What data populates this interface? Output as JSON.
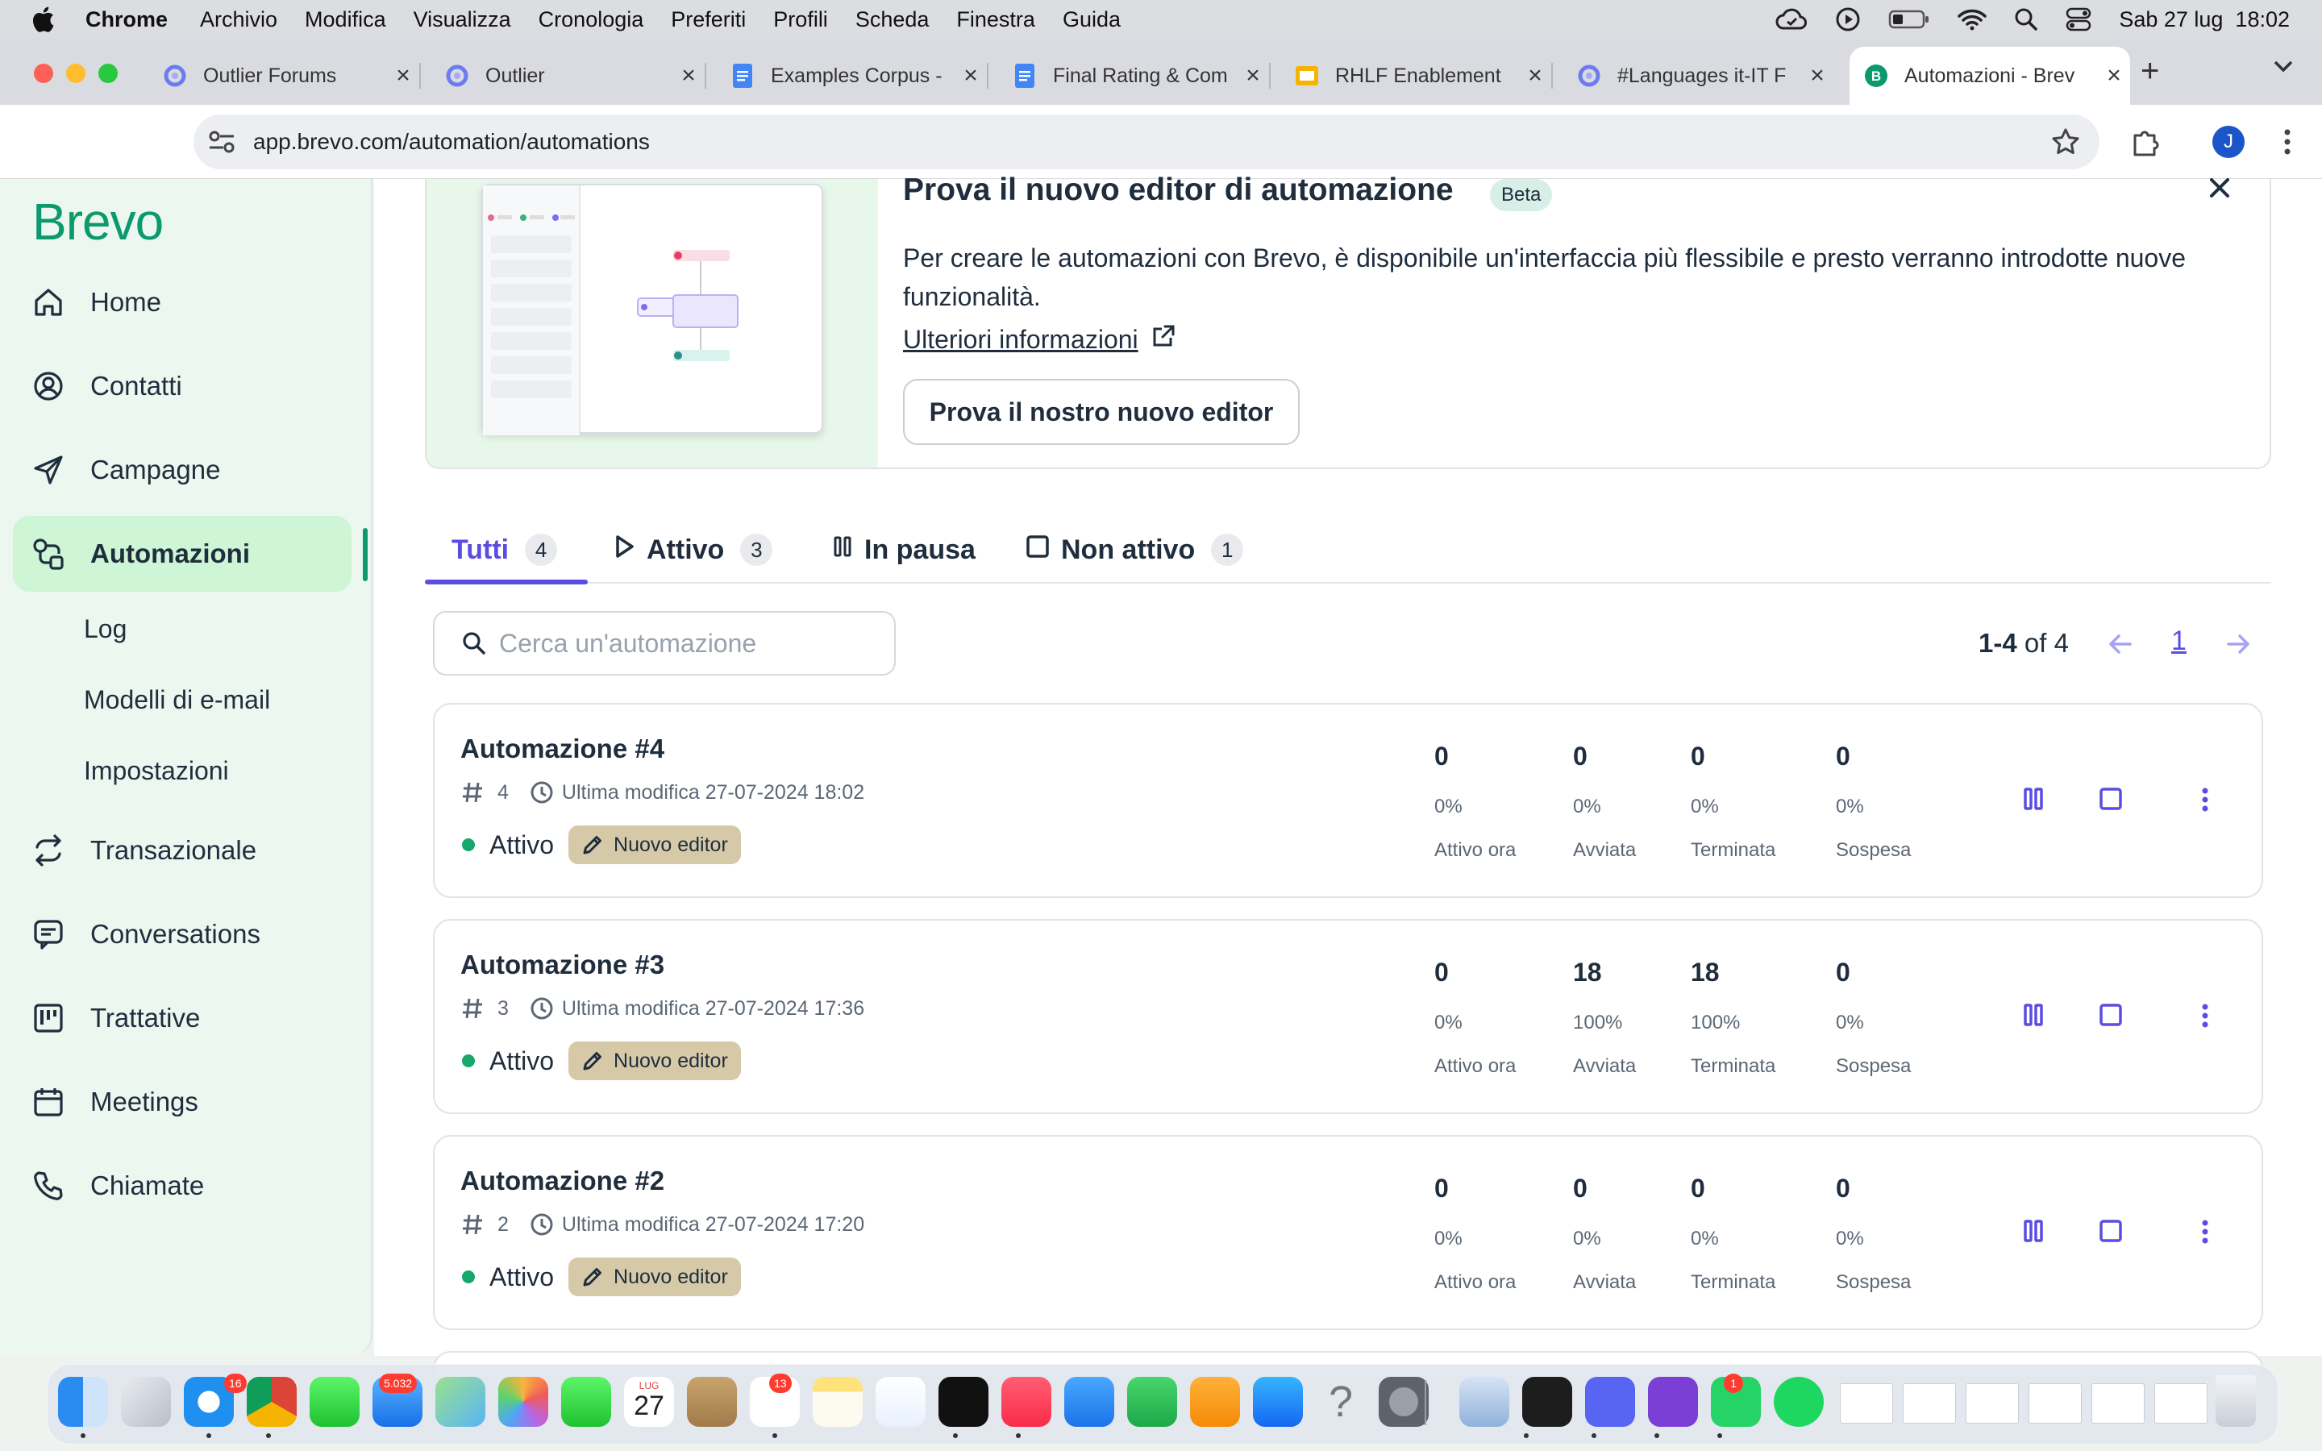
{
  "menubar": {
    "app": "Chrome",
    "items": [
      "Archivio",
      "Modifica",
      "Visualizza",
      "Cronologia",
      "Preferiti",
      "Profili",
      "Scheda",
      "Finestra",
      "Guida"
    ],
    "datetime": "Sab 27 lug  18:02"
  },
  "tabs": [
    {
      "title": "Outlier Forums",
      "icon": "outlier-icon"
    },
    {
      "title": "Outlier",
      "icon": "outlier-icon"
    },
    {
      "title": "Examples Corpus -",
      "icon": "google-docs-icon"
    },
    {
      "title": "Final Rating & Com",
      "icon": "google-docs-icon"
    },
    {
      "title": "RHLF Enablement",
      "icon": "google-slides-icon"
    },
    {
      "title": "#Languages it-IT F",
      "icon": "outlier-icon"
    },
    {
      "title": "Automazioni - Brev",
      "icon": "brevo-icon"
    }
  ],
  "address": {
    "url": "app.brevo.com/automation/automations"
  },
  "profile_initial": "J",
  "sidebar": {
    "logo": "Brevo",
    "items": [
      {
        "label": "Home",
        "icon": "home-icon"
      },
      {
        "label": "Contatti",
        "icon": "contacts-icon"
      },
      {
        "label": "Campagne",
        "icon": "send-icon"
      },
      {
        "label": "Automazioni",
        "icon": "automation-icon"
      },
      {
        "label": "Transazionale",
        "icon": "transactional-icon"
      },
      {
        "label": "Conversations",
        "icon": "chat-icon"
      },
      {
        "label": "Trattative",
        "icon": "deals-icon"
      },
      {
        "label": "Meetings",
        "icon": "calendar-icon"
      },
      {
        "label": "Chiamate",
        "icon": "phone-icon"
      }
    ],
    "sub_items": [
      "Log",
      "Modelli di e-mail",
      "Impostazioni"
    ]
  },
  "banner": {
    "title": "Prova il nuovo editor di automazione",
    "badge": "Beta",
    "description": "Per creare le automazioni con Brevo, è disponibile un'interfaccia più flessibile e presto verranno introdotte nuove funzionalità.",
    "link": "Ulteriori informazioni",
    "button": "Prova il nostro nuovo editor"
  },
  "filter_tabs": [
    {
      "label": "Tutti",
      "count": "4"
    },
    {
      "label": "Attivo",
      "count": "3"
    },
    {
      "label": "In pausa",
      "count": ""
    },
    {
      "label": "Non attivo",
      "count": "1"
    }
  ],
  "search": {
    "placeholder": "Cerca un'automazione"
  },
  "pagination": {
    "range": "1-4",
    "of": "of 4",
    "page": "1"
  },
  "automations": [
    {
      "title": "Automazione #4",
      "id": "4",
      "modified": "Ultima modifica 27-07-2024 18:02",
      "status": "Attivo",
      "editor": "Nuovo editor",
      "stats": [
        {
          "n": "0",
          "p": "0%",
          "l": "Attivo ora"
        },
        {
          "n": "0",
          "p": "0%",
          "l": "Avviata"
        },
        {
          "n": "0",
          "p": "0%",
          "l": "Terminata"
        },
        {
          "n": "0",
          "p": "0%",
          "l": "Sospesa"
        }
      ]
    },
    {
      "title": "Automazione #3",
      "id": "3",
      "modified": "Ultima modifica 27-07-2024 17:36",
      "status": "Attivo",
      "editor": "Nuovo editor",
      "stats": [
        {
          "n": "0",
          "p": "0%",
          "l": "Attivo ora"
        },
        {
          "n": "18",
          "p": "100%",
          "l": "Avviata"
        },
        {
          "n": "18",
          "p": "100%",
          "l": "Terminata"
        },
        {
          "n": "0",
          "p": "0%",
          "l": "Sospesa"
        }
      ]
    },
    {
      "title": "Automazione #2",
      "id": "2",
      "modified": "Ultima modifica 27-07-2024 17:20",
      "status": "Attivo",
      "editor": "Nuovo editor",
      "stats": [
        {
          "n": "0",
          "p": "0%",
          "l": "Attivo ora"
        },
        {
          "n": "0",
          "p": "0%",
          "l": "Avviata"
        },
        {
          "n": "0",
          "p": "0%",
          "l": "Terminata"
        },
        {
          "n": "0",
          "p": "0%",
          "l": "Sospesa"
        }
      ]
    }
  ],
  "dock": {
    "badges": {
      "messages": "16",
      "mail": "5.032",
      "reminders": "13",
      "whatsapp": "1"
    },
    "calendar_month": "LUG",
    "calendar_day": "27"
  },
  "colors": {
    "brand": "#0b996e",
    "accent": "#5b4de0",
    "active_bg": "#cdf5d6"
  }
}
